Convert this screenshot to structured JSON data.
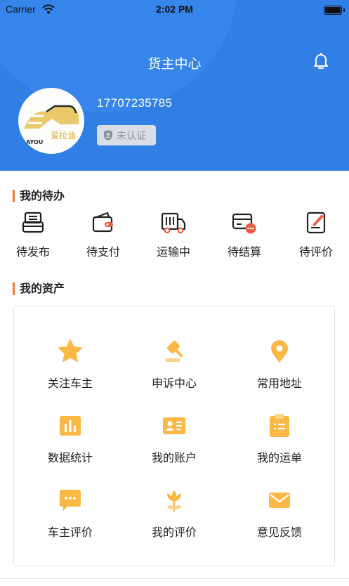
{
  "status_bar": {
    "carrier": "Carrier",
    "time": "2:02 PM"
  },
  "header": {
    "title": "货主中心",
    "phone": "17707235785",
    "verify_badge": "未认证",
    "avatar_logo_text": "爱拉油",
    "avatar_logo_sub": "LAYOU"
  },
  "todo": {
    "title": "我的待办",
    "items": [
      {
        "label": "待发布",
        "icon": "document-stack-icon"
      },
      {
        "label": "待支付",
        "icon": "wallet-icon"
      },
      {
        "label": "运输中",
        "icon": "truck-icon"
      },
      {
        "label": "待结算",
        "icon": "card-settle-icon"
      },
      {
        "label": "待评价",
        "icon": "edit-note-icon"
      }
    ]
  },
  "assets": {
    "title": "我的资产",
    "items": [
      {
        "label": "关注车主",
        "icon": "star-icon"
      },
      {
        "label": "申诉中心",
        "icon": "gavel-icon"
      },
      {
        "label": "常用地址",
        "icon": "location-pin-icon"
      },
      {
        "label": "数据统计",
        "icon": "bar-chart-icon"
      },
      {
        "label": "我的账户",
        "icon": "id-card-icon"
      },
      {
        "label": "我的运单",
        "icon": "clipboard-icon"
      },
      {
        "label": "车主评价",
        "icon": "chat-bubble-icon"
      },
      {
        "label": "我的评价",
        "icon": "flower-icon"
      },
      {
        "label": "意见反馈",
        "icon": "mail-icon"
      }
    ]
  },
  "colors": {
    "primary": "#2f7fe5",
    "accent_orange": "#f07d2c",
    "icon_yellow": "#fbb845"
  }
}
